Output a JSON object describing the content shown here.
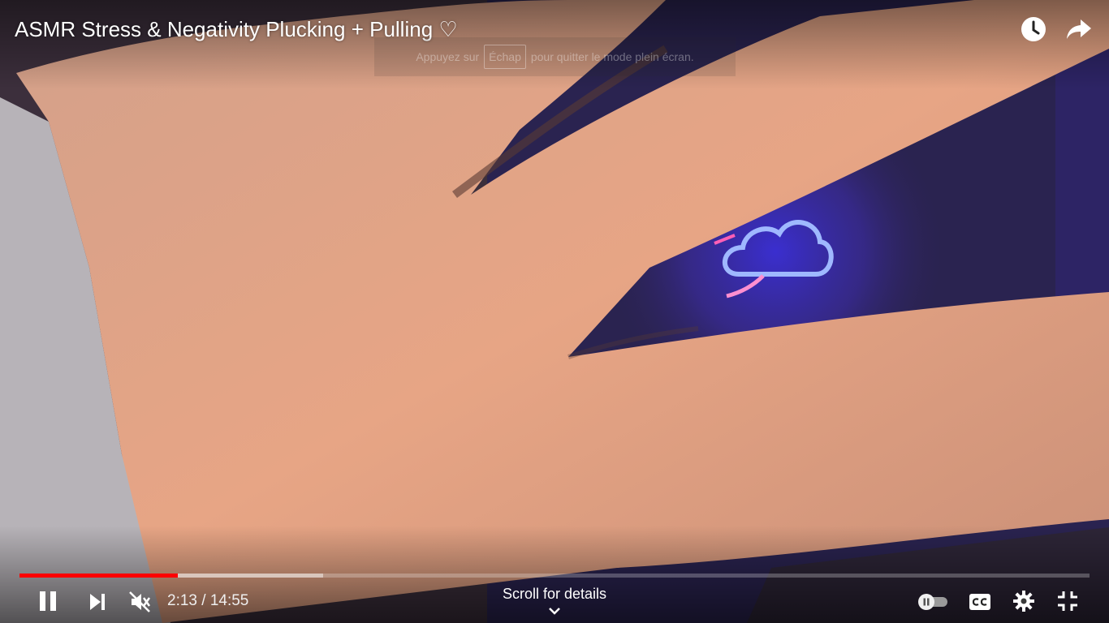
{
  "video": {
    "title": "ASMR Stress & Negativity Plucking + Pulling ♡",
    "current_time": "2:13",
    "separator": "/",
    "duration": "14:55",
    "played_fraction": 0.148,
    "buffered_fraction": 0.284
  },
  "fullscreen_notice": {
    "prefix": "Appuyez sur",
    "key": "Échap",
    "suffix": "pour quitter le mode plein écran."
  },
  "scroll_hint": "Scroll for details",
  "colors": {
    "progress_played": "#ff0000",
    "icon": "#ffffff"
  },
  "icons": {
    "top": [
      "clock-icon",
      "share-icon"
    ],
    "left_controls": [
      "pause-icon",
      "next-icon",
      "mute-icon"
    ],
    "right_controls": [
      "autoplay-toggle-icon",
      "captions-icon",
      "settings-icon",
      "exit-fullscreen-icon"
    ]
  }
}
